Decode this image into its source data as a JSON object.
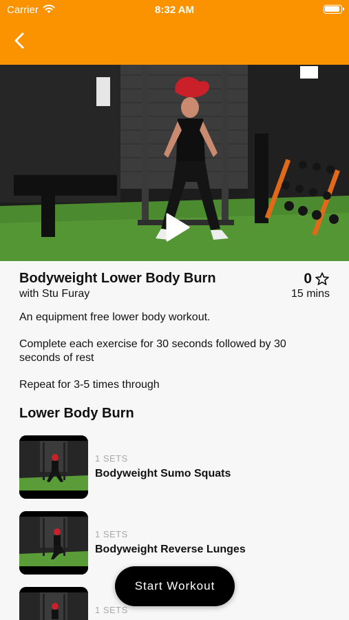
{
  "status_bar": {
    "carrier": "Carrier",
    "time": "8:32 AM"
  },
  "workout": {
    "title": "Bodyweight Lower Body Burn",
    "instructor": "with Stu Furay",
    "rating": "0",
    "duration": "15 mins",
    "description": [
      "An equipment free lower body workout.",
      "Complete each exercise for 30 seconds followed by 30 seconds of rest",
      "Repeat for 3-5 times through"
    ]
  },
  "section_title": "Lower Body Burn",
  "exercises": [
    {
      "sets": "1 SETS",
      "name": "Bodyweight Sumo Squats"
    },
    {
      "sets": "1 SETS",
      "name": "Bodyweight Reverse Lunges"
    },
    {
      "sets": "1 SETS",
      "name": ""
    }
  ],
  "start_button": "Start Workout",
  "colors": {
    "header": "#fb9200",
    "background": "#f7f7f7",
    "button": "#000000"
  },
  "icons": {
    "back": "chevron-left-icon",
    "play": "play-icon",
    "rating": "star-outline-icon",
    "wifi": "wifi-icon",
    "battery": "battery-icon"
  }
}
